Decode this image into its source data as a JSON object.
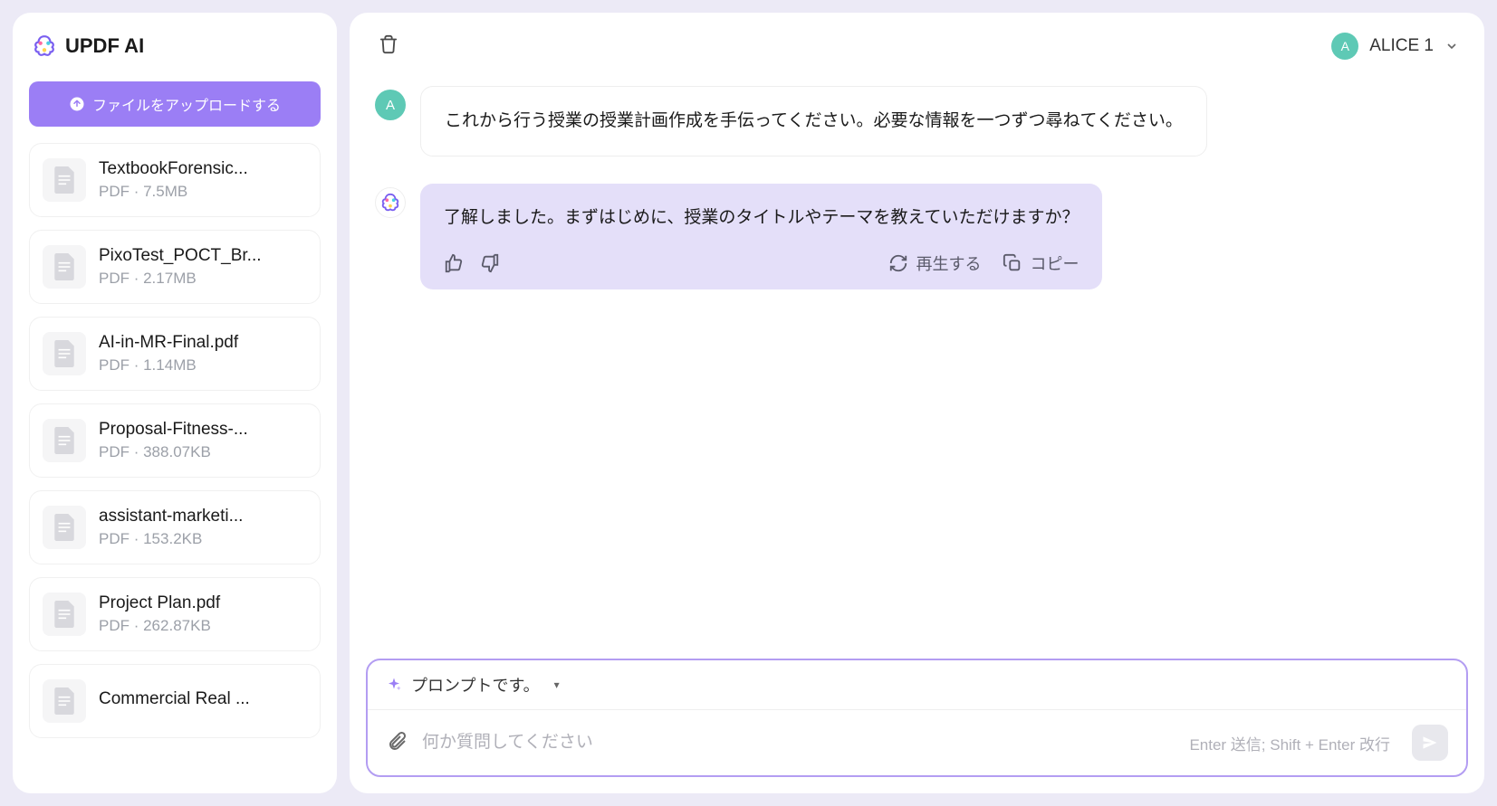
{
  "app": {
    "title": "UPDF AI"
  },
  "sidebar": {
    "upload_label": "ファイルをアップロードする",
    "files": [
      {
        "name": "TextbookForensic...",
        "meta": "PDF · 7.5MB"
      },
      {
        "name": "PixoTest_POCT_Br...",
        "meta": "PDF · 2.17MB"
      },
      {
        "name": "AI-in-MR-Final.pdf",
        "meta": "PDF · 1.14MB"
      },
      {
        "name": "Proposal-Fitness-...",
        "meta": "PDF · 388.07KB"
      },
      {
        "name": "assistant-marketi...",
        "meta": "PDF · 153.2KB"
      },
      {
        "name": "Project Plan.pdf",
        "meta": "PDF · 262.87KB"
      },
      {
        "name": "Commercial Real ...",
        "meta": ""
      }
    ]
  },
  "header": {
    "user_initial": "A",
    "user_name": "ALICE 1"
  },
  "chat": {
    "user_avatar_initial": "A",
    "user_message": "これから行う授業の授業計画作成を手伝ってください。必要な情報を一つずつ尋ねてください。",
    "ai_message": "了解しました。まずはじめに、授業のタイトルやテーマを教えていただけますか？",
    "regenerate_label": "再生する",
    "copy_label": "コピー"
  },
  "input": {
    "prompt_label": "プロンプトです。",
    "placeholder": "何か質問してください",
    "hint": "Enter 送信; Shift + Enter 改行"
  }
}
